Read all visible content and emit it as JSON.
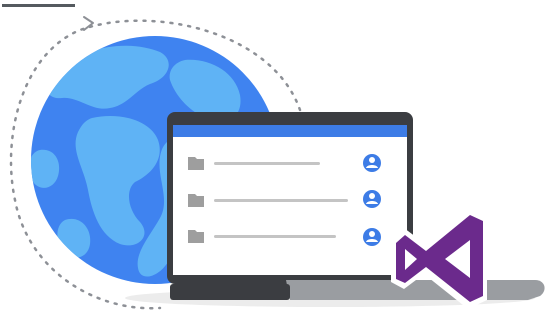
{
  "colors": {
    "globe_ocean": "#3f83f0",
    "globe_land": "#5fb3f5",
    "orbit_dots": "#8d9096",
    "laptop_frame": "#3b3d41",
    "laptop_base": "#9a9da1",
    "screen_header": "#3d7ce6",
    "screen_bg": "#ffffff",
    "folder_icon": "#9e9e9e",
    "line": "#c4c4c4",
    "user_icon": "#3d7ce6",
    "vs_logo": "#6b2a8c",
    "shadow": "#ececec",
    "top_rule": "#555a5f"
  },
  "icons": {
    "globe": "globe-icon",
    "orbit_arrow": "arrow-icon",
    "folder": "folder-icon",
    "user": "user-circle-icon",
    "visual_studio": "visual-studio-logo"
  },
  "list_rows": [
    {
      "folder_icon": "folder-icon",
      "user_icon": "user-circle-icon"
    },
    {
      "folder_icon": "folder-icon",
      "user_icon": "user-circle-icon"
    },
    {
      "folder_icon": "folder-icon",
      "user_icon": "user-circle-icon"
    }
  ]
}
